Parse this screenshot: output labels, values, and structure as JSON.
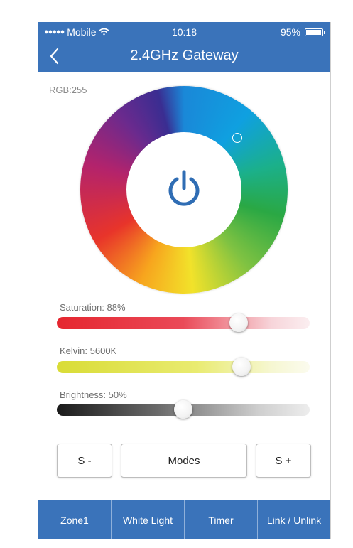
{
  "status_bar": {
    "signal": "●●●●●",
    "carrier": "Mobile",
    "time": "10:18",
    "battery_text": "95%",
    "battery_level": 0.95
  },
  "header": {
    "title": "2.4GHz Gateway",
    "back_icon": "chevron-left-icon"
  },
  "color_wheel": {
    "rgb_label": "RGB:255",
    "power_icon": "power-icon"
  },
  "sliders": [
    {
      "label": "Saturation: 88%",
      "value": 0.72
    },
    {
      "label": "Kelvin: 5600K",
      "value": 0.73
    },
    {
      "label": "Brightness: 50%",
      "value": 0.5
    }
  ],
  "buttons": {
    "s_minus": "S -",
    "modes": "Modes",
    "s_plus": "S +"
  },
  "tabs": [
    "Zone1",
    "White Light",
    "Timer",
    "Link / Unlink"
  ],
  "colors": {
    "accent": "#3a73ba"
  }
}
